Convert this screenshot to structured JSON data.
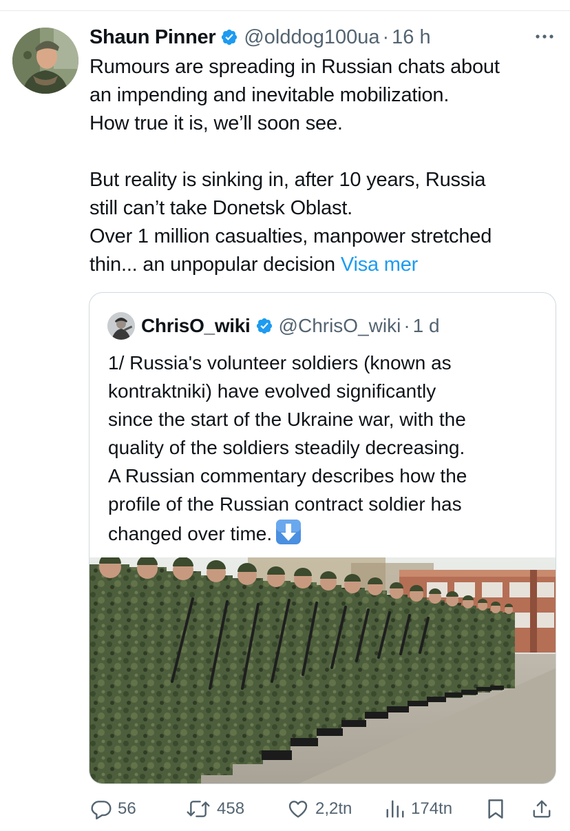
{
  "tweet": {
    "author_name": "Shaun Pinner",
    "handle": "@olddog100ua",
    "separator": "·",
    "time": "16 h",
    "text_lines": [
      "Rumours are spreading in Russian chats about",
      "an impending and inevitable mobilization.",
      "How true it is, we’ll soon see.",
      "But reality is sinking in, after 10 years, Russia",
      "still can’t take Donetsk Oblast.",
      "Over 1 million casualties, manpower stretched",
      "thin... an unpopular decision"
    ],
    "show_more_label": "Visa mer",
    "more_icon": "more-horizontal-icon"
  },
  "quote": {
    "author_name": "ChrisO_wiki",
    "handle": "@ChrisO_wiki",
    "separator": "·",
    "time": "1 d",
    "text_lines": [
      "1/ Russia's volunteer soldiers (known as",
      "kontraktniki) have evolved significantly",
      "since the start of the Ukraine war, with the",
      "quality of the soldiers steadily decreasing.",
      "A Russian commentary describes how the",
      "profile of the Russian contract soldier has",
      "changed over time."
    ],
    "emoji": "down-arrow-emoji",
    "image": "photo of soldiers in camouflage standing in a line"
  },
  "actions": {
    "replies": "56",
    "reposts": "458",
    "likes": "2,2tn",
    "views": "174tn"
  },
  "colors": {
    "text": "#0f1419",
    "secondary": "#536471",
    "accent": "#1d9bf0",
    "border": "#cfd9de"
  }
}
